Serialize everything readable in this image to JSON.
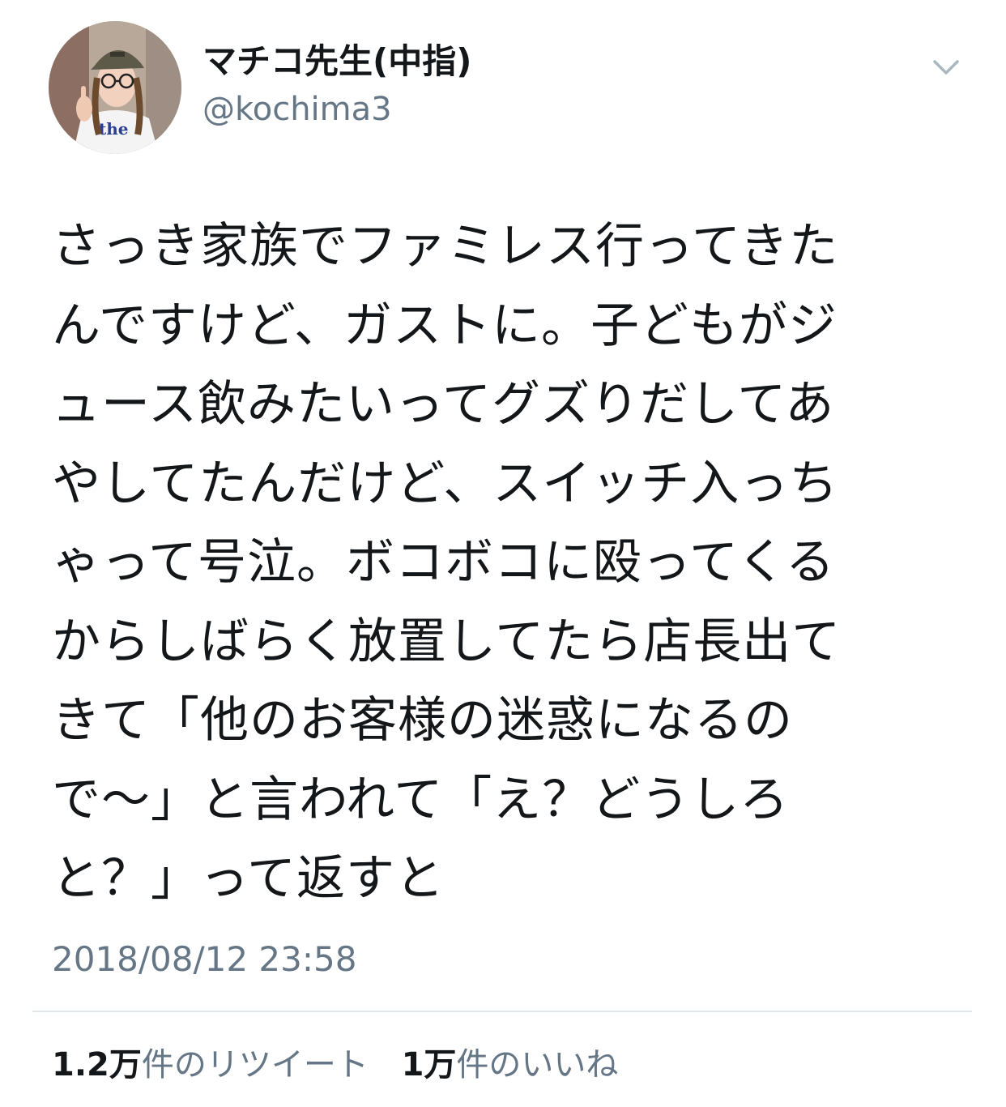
{
  "tweet": {
    "author": {
      "display_name": "マチコ先生(中指)",
      "handle": "@kochima3",
      "avatar_icon": "avatar-photo"
    },
    "menu_icon": "chevron-down-icon",
    "text_lines": [
      "さっき家族でファミレス行ってきた",
      "んですけど、ガストに。子どもがジ",
      "ュース飲みたいってグズりだしてあ",
      "やしてたんだけど、スイッチ入っち",
      "ゃって号泣。ボコボコに殴ってくる",
      "からしばらく放置してたら店長出て",
      "きて「他のお客様の迷惑になるの",
      "で〜」と言われて「え？どうしろ",
      "と？」って返すと"
    ],
    "timestamp": "2018/08/12 23:58",
    "stats": {
      "retweets_count": "1.2万",
      "retweets_label": "件のリツイート",
      "likes_count": "1万",
      "likes_label": "件のいいね"
    }
  },
  "colors": {
    "text_primary": "#14171a",
    "text_secondary": "#657786",
    "divider": "#e1e8ed",
    "chevron": "#aab8c2"
  }
}
